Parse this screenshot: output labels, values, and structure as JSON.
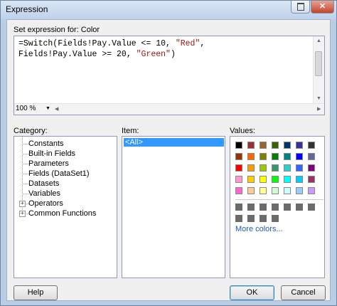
{
  "window": {
    "title": "Expression",
    "restore_icon": "restore-icon",
    "close_label": "✕"
  },
  "editor": {
    "label": "Set expression for: Color",
    "line1_a": "=Switch(Fields!Pay.Value <= 10, ",
    "line1_b": "\"Red\"",
    "line1_c": ",",
    "line2_a": "Fields!Pay.Value >= 20, ",
    "line2_b": "\"Green\"",
    "line2_c": ")",
    "zoom": "100 %"
  },
  "category": {
    "label": "Category:",
    "items": [
      "Constants",
      "Built-in Fields",
      "Parameters",
      "Fields (DataSet1)",
      "Datasets",
      "Variables",
      "Operators",
      "Common Functions"
    ]
  },
  "item": {
    "label": "Item:",
    "selected": "<All>"
  },
  "values": {
    "label": "Values:",
    "more_colors": "More colors...",
    "colors": [
      [
        "#000000",
        "#993333",
        "#996633",
        "#336600",
        "#003366",
        "#333399",
        "#333333"
      ],
      [
        "#993300",
        "#ff6600",
        "#808000",
        "#008000",
        "#008080",
        "#0000ff",
        "#666699"
      ],
      [
        "#ff0000",
        "#ff9900",
        "#99cc00",
        "#339966",
        "#33cccc",
        "#3366ff",
        "#800080"
      ],
      [
        "#ff99cc",
        "#ffcc00",
        "#ffff00",
        "#00ff00",
        "#00ffff",
        "#00ccff",
        "#993366"
      ],
      [
        "#ff66cc",
        "#ffcc99",
        "#ffff99",
        "#ccffcc",
        "#ccffff",
        "#99ccff",
        "#cc99ff"
      ]
    ],
    "gray_row1": 7,
    "gray_row2": 4
  },
  "buttons": {
    "help": "Help",
    "ok": "OK",
    "cancel": "Cancel"
  }
}
